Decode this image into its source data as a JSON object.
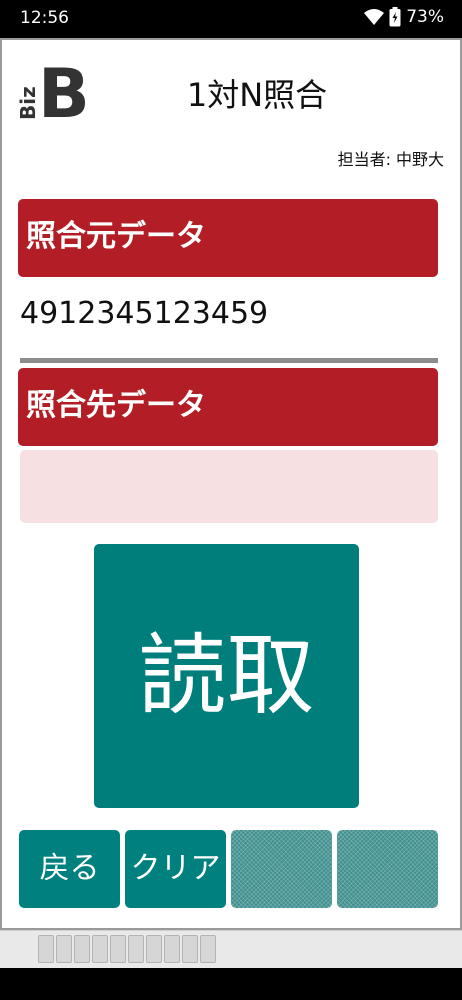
{
  "status_bar": {
    "time": "12:56",
    "battery_percent": "73%",
    "icons": [
      "wifi-icon",
      "battery-icon"
    ]
  },
  "header": {
    "logo_text_small": "Biz",
    "logo_text_big": "B",
    "title": "1対N照合",
    "operator_label": "担当者:",
    "operator_name": "中野大"
  },
  "source": {
    "label": "照合元データ",
    "value": "4912345123459"
  },
  "destination": {
    "label": "照合先データ",
    "value": ""
  },
  "read_button": {
    "label": "読取"
  },
  "function_buttons": [
    {
      "label": "戻る"
    },
    {
      "label": "クリア"
    },
    {
      "label": ""
    },
    {
      "label": ""
    }
  ],
  "colors": {
    "section_header": "#b31e26",
    "accent_teal": "#007e7b",
    "dest_field_bg": "#f7e0e1"
  }
}
